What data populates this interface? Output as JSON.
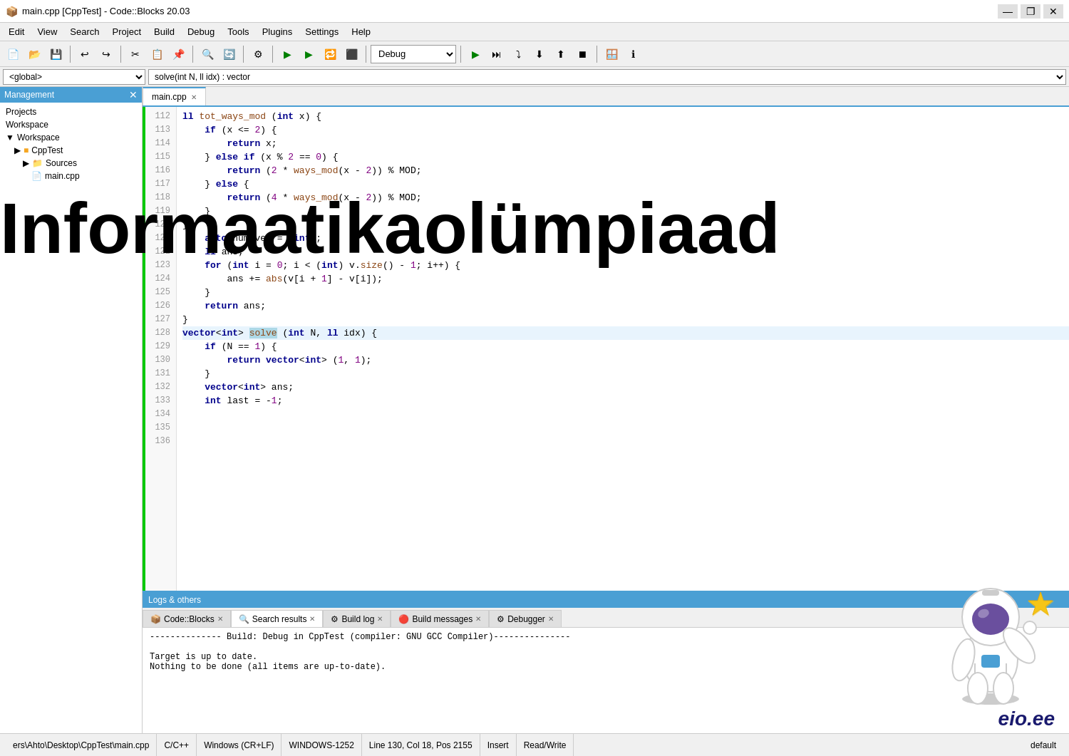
{
  "titlebar": {
    "title": "main.cpp [CppTest] - Code::Blocks 20.03",
    "minimize": "—",
    "maximize": "❐",
    "close": "✕"
  },
  "menubar": {
    "items": [
      "Edit",
      "View",
      "Search",
      "Project",
      "Build",
      "Debug",
      "Tools",
      "Plugins",
      "Settings",
      "Help"
    ]
  },
  "toolbar": {
    "dropdown_label": "Debug",
    "icons": [
      "new",
      "open",
      "save",
      "cut",
      "copy",
      "paste",
      "undo",
      "redo",
      "search",
      "replace",
      "build",
      "run",
      "rebuild",
      "stop",
      "debug",
      "run-to-cursor",
      "step-over",
      "step-into",
      "step-out",
      "stop-debug",
      "attach",
      "detach",
      "windows",
      "info"
    ]
  },
  "scope_bar": {
    "left_value": "<global>",
    "right_value": "solve(int N, ll idx) : vector"
  },
  "sidebar": {
    "title": "Management",
    "tabs": [
      "Projects",
      "Workspace"
    ],
    "tree": {
      "workspace": "Workspace",
      "project": "CppTest",
      "sources_label": "Sources",
      "file": "main.cpp"
    }
  },
  "editor": {
    "tab_label": "main.cpp",
    "lines": [
      {
        "num": 112,
        "code": "ll tot_ways_mod (int x) {",
        "type": "fn"
      },
      {
        "num": 113,
        "code": "    if (x <= 2) {",
        "type": "normal"
      },
      {
        "num": 114,
        "code": "        return x;",
        "type": "normal"
      },
      {
        "num": 115,
        "code": "    } else if (x % 2 == 0) {",
        "type": "normal"
      },
      {
        "num": 116,
        "code": "        return (2 * ways_mod(x - 2)) % MOD;",
        "type": "normal"
      },
      {
        "num": 117,
        "code": "    } else {",
        "type": "normal"
      },
      {
        "num": 118,
        "code": "        return (4 * ways_mod(x - 2)) % MOD;",
        "type": "normal"
      },
      {
        "num": 119,
        "code": "    }",
        "type": "normal"
      },
      {
        "num": 120,
        "code": "}",
        "type": "normal"
      },
      {
        "num": 121,
        "code": "",
        "type": "normal"
      },
      {
        "num": 122,
        "code": "    auto num_vec = <int>;",
        "type": "normal"
      },
      {
        "num": 123,
        "code": "    ll ans;",
        "type": "normal"
      },
      {
        "num": 124,
        "code": "    for (int i = 0; i < (int) v.size() - 1; i++) {",
        "type": "normal"
      },
      {
        "num": 125,
        "code": "        ans += abs(v[i + 1] - v[i]);",
        "type": "normal"
      },
      {
        "num": 126,
        "code": "    }",
        "type": "normal"
      },
      {
        "num": 127,
        "code": "    return ans;",
        "type": "normal"
      },
      {
        "num": 128,
        "code": "}",
        "type": "normal"
      },
      {
        "num": 129,
        "code": "",
        "type": "normal"
      },
      {
        "num": 130,
        "code": "vector<int> solve (int N, ll idx) {",
        "type": "selected"
      },
      {
        "num": 131,
        "code": "    if (N == 1) {",
        "type": "normal"
      },
      {
        "num": 132,
        "code": "        return vector<int> (1, 1);",
        "type": "normal"
      },
      {
        "num": 133,
        "code": "    }",
        "type": "normal"
      },
      {
        "num": 134,
        "code": "",
        "type": "normal"
      },
      {
        "num": 135,
        "code": "    vector<int> ans;",
        "type": "normal"
      },
      {
        "num": 136,
        "code": "    int last = -1;",
        "type": "normal"
      }
    ]
  },
  "bottom_panel": {
    "header": "Logs & others",
    "tabs": [
      {
        "label": "Code::Blocks",
        "icon": "cb"
      },
      {
        "label": "Search results",
        "icon": "search"
      },
      {
        "label": "Build log",
        "icon": "build"
      },
      {
        "label": "Build messages",
        "icon": "msg"
      },
      {
        "label": "Debugger",
        "icon": "debug"
      }
    ],
    "active_tab": 1,
    "content_lines": [
      "-------------- Build: Debug in CppTest (compiler: GNU GCC Compiler)---------------",
      "",
      "Target is up to date.",
      "Nothing to be done (all items are up-to-date)."
    ]
  },
  "statusbar": {
    "file_path": "ers\\Ahto\\Desktop\\CppTest\\main.cpp",
    "language": "C/C++",
    "line_endings": "Windows (CR+LF)",
    "encoding": "WINDOWS-1252",
    "position": "Line 130, Col 18, Pos 2155",
    "mode": "Insert",
    "rw": "Read/Write",
    "indent": "default"
  },
  "watermark": {
    "text": "Informaatikaolümpiaad"
  },
  "eio": {
    "label": "eio.ee"
  }
}
